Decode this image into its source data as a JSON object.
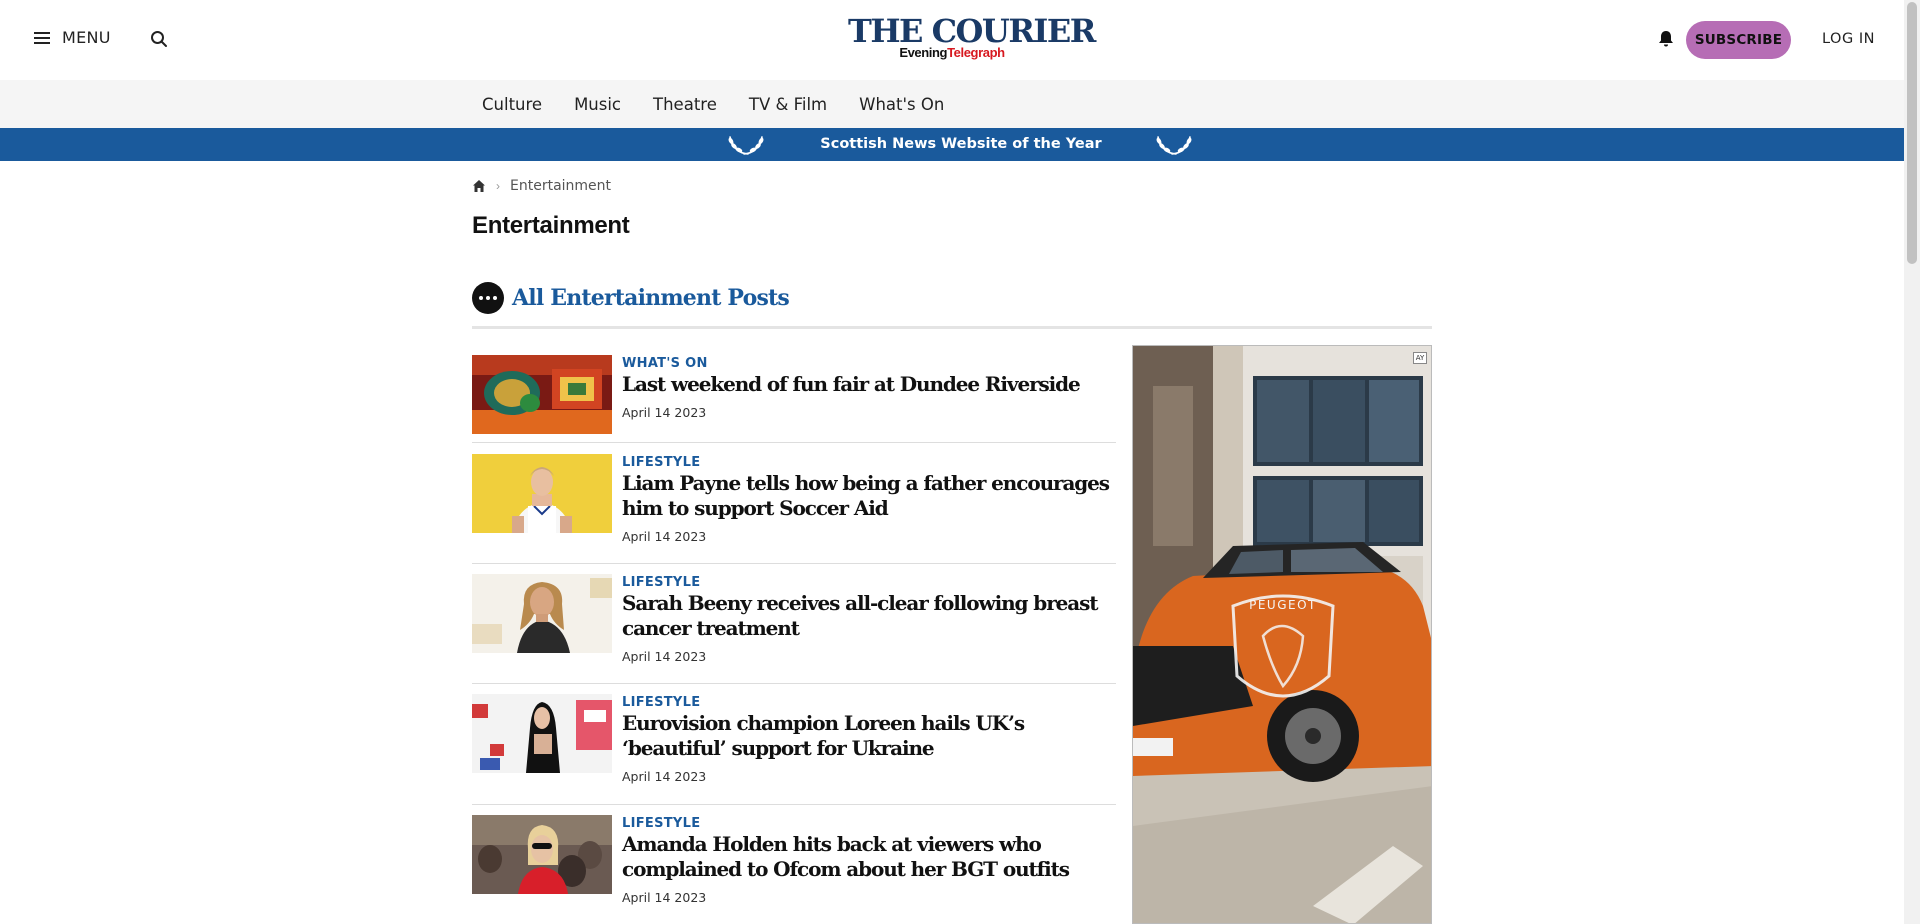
{
  "header": {
    "menu_label": "MENU",
    "logo_main": "THE COURIER",
    "logo_sub_1": "Evening",
    "logo_sub_2": "Telegraph",
    "subscribe_label": "SUBSCRIBE",
    "login_label": "LOG IN"
  },
  "subnav": {
    "items": [
      "Culture",
      "Music",
      "Theatre",
      "TV & Film",
      "What's On"
    ]
  },
  "banner": {
    "text": "Scottish News Website of the Year"
  },
  "breadcrumb": {
    "current": "Entertainment"
  },
  "page_title": "Entertainment",
  "section": {
    "title": "All Entertainment Posts"
  },
  "articles": [
    {
      "category": "WHAT'S ON",
      "headline": "Last weekend of fun fair at Dundee Riverside",
      "date": "April 14 2023"
    },
    {
      "category": "LIFESTYLE",
      "headline": "Liam Payne tells how being a father encourages him to support Soccer Aid",
      "date": "April 14 2023"
    },
    {
      "category": "LIFESTYLE",
      "headline": "Sarah Beeny receives all-clear following breast cancer treatment",
      "date": "April 14 2023"
    },
    {
      "category": "LIFESTYLE",
      "headline": "Eurovision champion Loreen hails UK’s ‘beautiful’ support for Ukraine",
      "date": "April 14 2023"
    },
    {
      "category": "LIFESTYLE",
      "headline": "Amanda Holden hits back at viewers who complained to Ofcom about her BGT outfits",
      "date": "April 14 2023"
    }
  ],
  "ad": {
    "brand": "PEUGEOT",
    "badge": "AY"
  },
  "colors": {
    "brand_blue": "#1a5a9c",
    "logo_navy": "#1a3a66",
    "subscribe_bg": "#b66db5",
    "telegraph_red": "#d71920"
  }
}
